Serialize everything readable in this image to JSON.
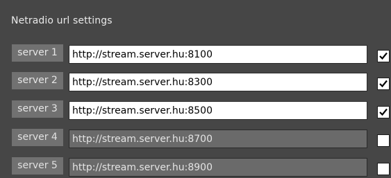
{
  "window": {
    "title": "Netradio url settings"
  },
  "servers": [
    {
      "label": "server 1",
      "url": "http://stream.server.hu:8100",
      "enabled": true
    },
    {
      "label": "server 2",
      "url": "http://stream.server.hu:8300",
      "enabled": true
    },
    {
      "label": "server 3",
      "url": "http://stream.server.hu:8500",
      "enabled": true
    },
    {
      "label": "server 4",
      "url": "http://stream.server.hu:8700",
      "enabled": false
    },
    {
      "label": "server 5",
      "url": "http://stream.server.hu:8900",
      "enabled": false
    }
  ],
  "colors": {
    "background": "#464646",
    "label_background": "#717171",
    "enabled_field": "#ffffff",
    "disabled_field": "#6a6a6a"
  }
}
